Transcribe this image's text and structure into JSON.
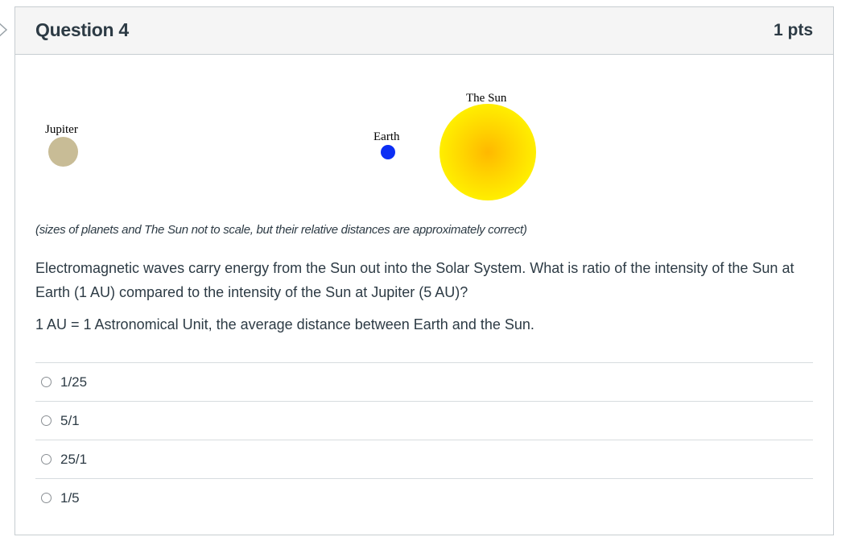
{
  "question": {
    "title": "Question 4",
    "points": "1 pts"
  },
  "diagram": {
    "bodies": [
      {
        "name": "Jupiter",
        "color": "#c8bc96"
      },
      {
        "name": "Earth",
        "color": "#0c2ef4"
      },
      {
        "name": "The Sun",
        "color": "#ffd400"
      }
    ],
    "caption": "(sizes of planets and The Sun not to scale, but their relative distances are approximately correct)"
  },
  "body_text": {
    "question": "Electromagnetic waves carry energy from the Sun out into the Solar System. What is ratio of the intensity of the Sun at Earth (1 AU) compared to the intensity of the Sun at Jupiter (5 AU)?",
    "note": "1 AU = 1 Astronomical Unit, the average distance between Earth and the Sun."
  },
  "answers": [
    {
      "label": "1/25",
      "selected": false
    },
    {
      "label": "5/1",
      "selected": false
    },
    {
      "label": "25/1",
      "selected": false
    },
    {
      "label": "1/5",
      "selected": false
    }
  ],
  "icons": {
    "edge": "chevron-right-icon"
  }
}
